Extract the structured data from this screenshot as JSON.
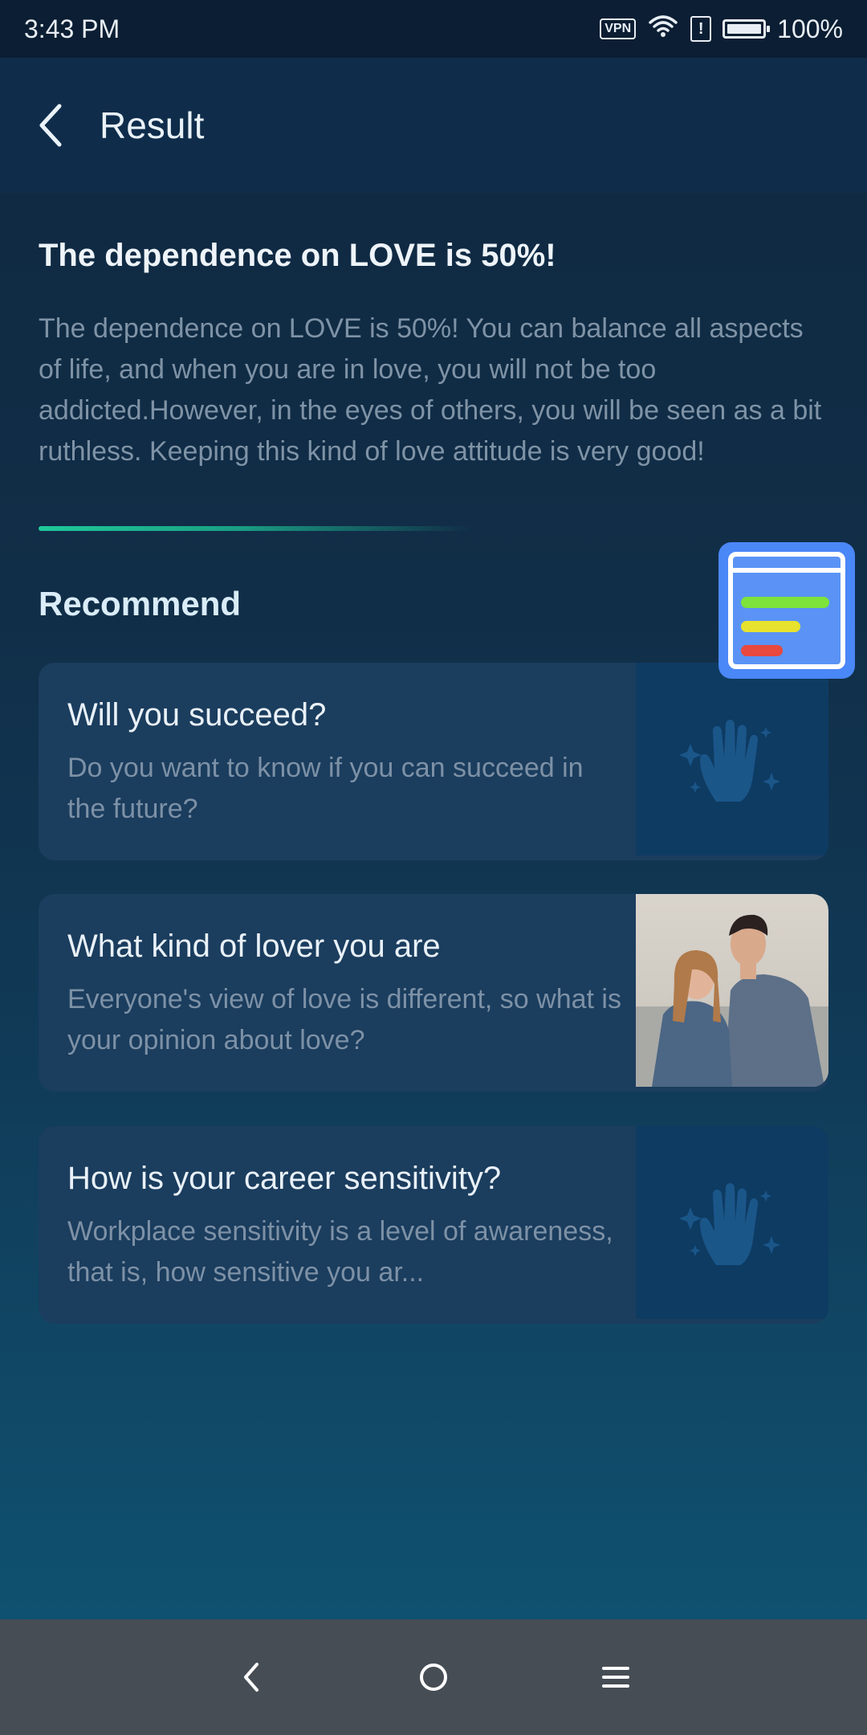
{
  "status_bar": {
    "time": "3:43 PM",
    "vpn_label": "VPN",
    "alert_label": "!",
    "battery_text": "100%",
    "icons": [
      "vpn-icon",
      "wifi-icon",
      "alert-icon",
      "battery-icon"
    ]
  },
  "app_bar": {
    "title": "Result",
    "back_icon": "back-arrow-icon"
  },
  "result": {
    "title": "The dependence on LOVE is 50%!",
    "description": "The dependence on LOVE is 50%! You can balance all aspects of life, and when you are in love, you will not be too addicted.However, in the eyes of others, you will be seen as a bit ruthless. Keeping this kind of love attitude is very good!"
  },
  "recommend": {
    "section_title": "Recommend",
    "items": [
      {
        "title": "Will you succeed?",
        "subtitle": "Do you want to know if you can succeed in the future?",
        "thumb": "palm-hand-icon"
      },
      {
        "title": "What kind of lover you are",
        "subtitle": "Everyone's view of love is different, so what is your opinion about love?",
        "thumb": "couple-photo"
      },
      {
        "title": "How is your career sensitivity?",
        "subtitle": "Workplace sensitivity is a level of awareness, that is, how sensitive you ar...",
        "thumb": "palm-hand-icon"
      }
    ]
  },
  "floating_widget": {
    "icon": "report-card-icon"
  },
  "nav_bar": {
    "icons": [
      "nav-back-icon",
      "nav-home-icon",
      "nav-menu-icon"
    ]
  },
  "colors": {
    "accent_divider": "#1fc99a",
    "card_bg": "#1b3d5e",
    "widget_blue": "#4a87f7"
  }
}
